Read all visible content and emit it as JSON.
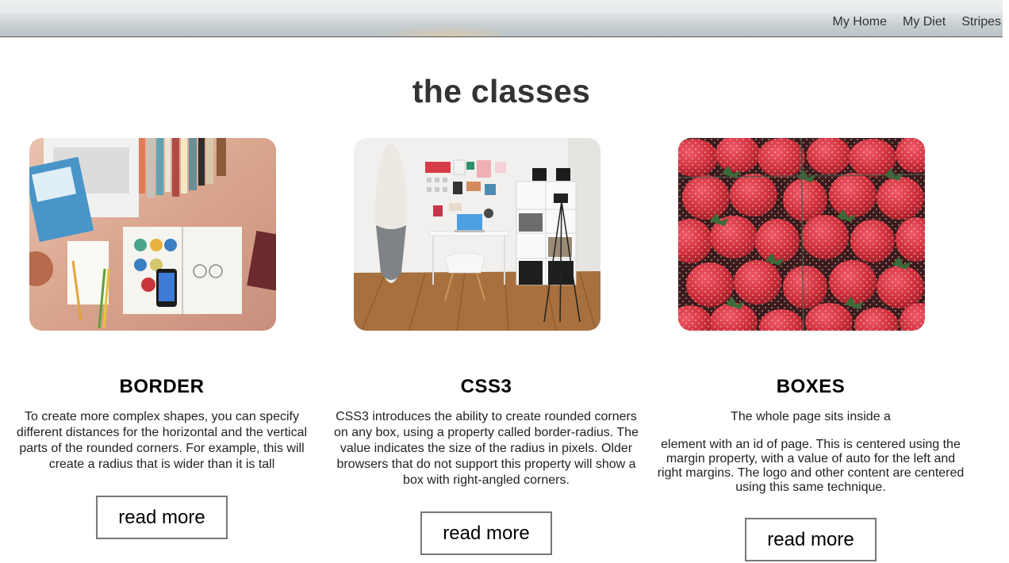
{
  "nav": {
    "items": [
      "My Home",
      "My Diet",
      "Stripes"
    ]
  },
  "page": {
    "title": "the classes"
  },
  "cards": [
    {
      "heading": "BORDER",
      "paragraphs": [
        "To create more complex shapes, you can specify different distances for the horizontal and the vertical parts of the rounded corners. For example, this will create a radius that is wider than it is tall"
      ],
      "button": "read more",
      "image": "desk-workspace-photo"
    },
    {
      "heading": "CSS3",
      "paragraphs": [
        "CSS3 introduces the ability to create rounded corners on any box, using a property called border-radius. The value indicates the size of the radius in pixels. Older browsers that do not support this property will show a box with right-angled corners."
      ],
      "button": "read more",
      "image": "room-with-surfboard-photo"
    },
    {
      "heading": "BOXES",
      "paragraphs": [
        "The whole page sits inside a",
        "element with an id of page. This is centered using the margin property, with a value of auto for the left and right margins. The logo and other content are centered using this same technique."
      ],
      "button": "read more",
      "image": "strawberries-photo"
    }
  ],
  "colors": {
    "text": "#333333",
    "heading": "#000000",
    "button_border": "#777777",
    "strawberry": "#c8283e"
  }
}
